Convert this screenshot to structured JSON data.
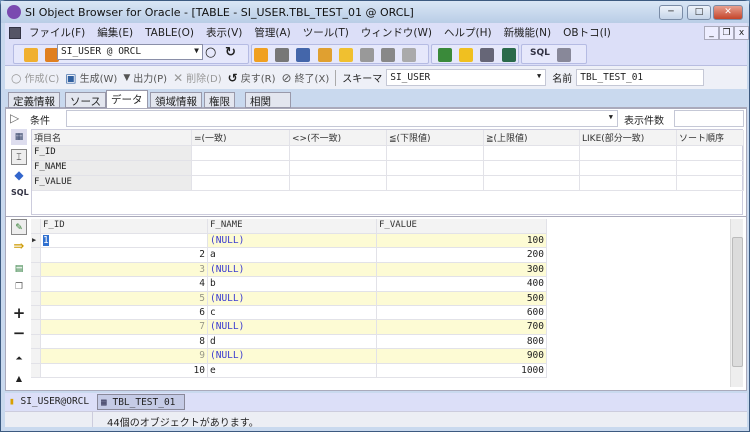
{
  "window": {
    "title": "SI Object Browser for Oracle - [TABLE - SI_USER.TBL_TEST_01 @ ORCL]",
    "min": "─",
    "max": "□",
    "close": "✕"
  },
  "menu": [
    "ファイル(F)",
    "編集(E)",
    "TABLE(O)",
    "表示(V)",
    "管理(A)",
    "ツール(T)",
    "ウィンドウ(W)",
    "ヘルプ(H)",
    "新機能(N)",
    "OBトコ(I)"
  ],
  "mdi": {
    "min": "_",
    "restore": "❐",
    "close": "x"
  },
  "toolbar": {
    "connection": "SI_USER @ ORCL",
    "sql1": "SQL",
    "sql2": "SQL"
  },
  "actions": {
    "create": "作成(C)",
    "generate": "生成(W)",
    "output": "出力(P)",
    "delete": "削除(D)",
    "revert": "戻す(R)",
    "exit": "終了(X)",
    "schema_label": "スキーマ",
    "schema": "SI_USER",
    "name_label": "名前",
    "name": "TBL_TEST_01"
  },
  "tabs": [
    "定義情報",
    "ソース",
    "データ",
    "領域情報",
    "権限",
    "相関"
  ],
  "condition": {
    "label": "条件",
    "value": "",
    "count_label": "表示件数",
    "count": "",
    "headers": [
      "項目名",
      "=(一致)",
      "<>(不一致)",
      "≦(下限値)",
      "≧(上限値)",
      "LIKE(部分一致)",
      "ソート順序"
    ],
    "fields": [
      "F_ID",
      "F_NAME",
      "F_VALUE"
    ]
  },
  "grid": {
    "headers": [
      "F_ID",
      "F_NAME",
      "F_VALUE"
    ],
    "rows": [
      [
        "1",
        "(NULL)",
        "100"
      ],
      [
        "2",
        "a",
        "200"
      ],
      [
        "3",
        "(NULL)",
        "300"
      ],
      [
        "4",
        "b",
        "400"
      ],
      [
        "5",
        "(NULL)",
        "500"
      ],
      [
        "6",
        "c",
        "600"
      ],
      [
        "7",
        "(NULL)",
        "700"
      ],
      [
        "8",
        "d",
        "800"
      ],
      [
        "9",
        "(NULL)",
        "900"
      ],
      [
        "10",
        "e",
        "1000"
      ]
    ]
  },
  "doc_tabs": {
    "connection": "SI_USER@ORCL",
    "table": "TBL_TEST_01"
  },
  "status": "44個のオブジェクトがあります。",
  "colors": {
    "row_alt": "#fdfbd4",
    "null_text": "#3a3ad0"
  }
}
